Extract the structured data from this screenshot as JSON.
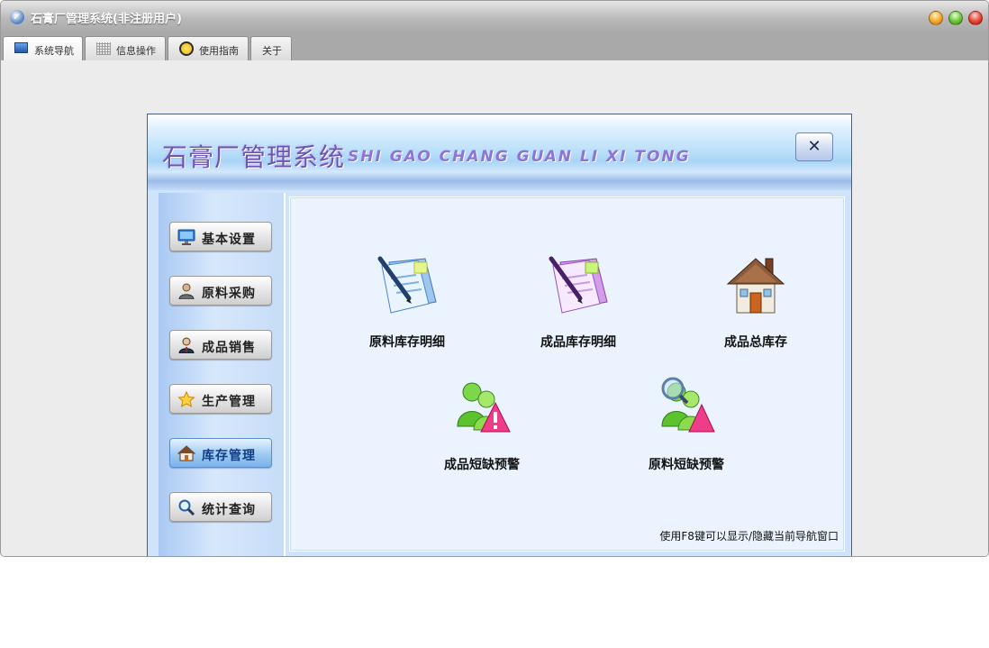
{
  "window": {
    "title": "石膏厂管理系统(非注册用户)"
  },
  "tabs": [
    {
      "label": "系统导航",
      "icon": "monitor-icon"
    },
    {
      "label": "信息操作",
      "icon": "grid-icon"
    },
    {
      "label": "使用指南",
      "icon": "compass-icon"
    },
    {
      "label": "关于",
      "icon": ""
    }
  ],
  "banner": {
    "title_cn": "石膏厂管理系统",
    "title_en": "SHI GAO CHANG GUAN LI XI TONG",
    "close_label": "✕"
  },
  "sidebar": {
    "items": [
      {
        "label": "基本设置",
        "icon": "monitor-icon"
      },
      {
        "label": "原料采购",
        "icon": "user-icon"
      },
      {
        "label": "成品销售",
        "icon": "business-user-icon"
      },
      {
        "label": "生产管理",
        "icon": "star-icon"
      },
      {
        "label": "库存管理",
        "icon": "house-icon"
      },
      {
        "label": "统计查询",
        "icon": "magnifier-icon"
      }
    ]
  },
  "main": {
    "tiles": [
      {
        "label": "原料库存明细",
        "icon": "blue-document-icon"
      },
      {
        "label": "成品库存明细",
        "icon": "purple-document-icon"
      },
      {
        "label": "成品总库存",
        "icon": "house-icon"
      },
      {
        "label": "成品短缺预警",
        "icon": "users-alert-icon"
      },
      {
        "label": "原料短缺预警",
        "icon": "users-search-icon"
      }
    ],
    "hint": "使用F8键可以显示/隐藏当前导航窗口"
  },
  "colors": {
    "title_purple": "#6c55b3",
    "sidebar_blue": "#a9c9f3",
    "active_button": "#9fcaf3"
  }
}
